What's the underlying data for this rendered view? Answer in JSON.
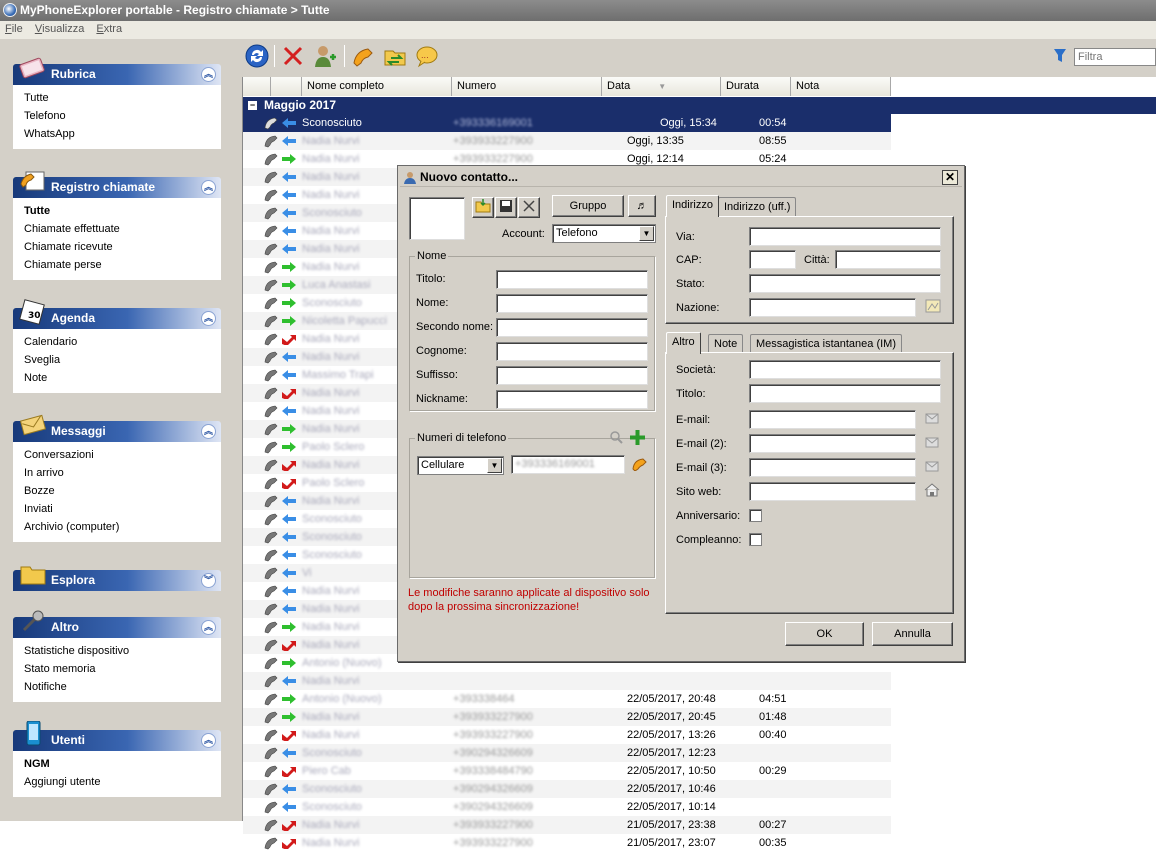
{
  "window": {
    "title": "MyPhoneExplorer portable -  Registro chiamate > Tutte"
  },
  "menu": [
    {
      "key": "F",
      "rest": "ile"
    },
    {
      "key": "V",
      "rest": "isualizza"
    },
    {
      "key": "E",
      "rest": "xtra"
    }
  ],
  "sidebar": {
    "rubrica": {
      "title": "Rubrica",
      "items": [
        "Tutte",
        "Telefono",
        "WhatsApp"
      ]
    },
    "registro": {
      "title": "Registro chiamate",
      "items": [
        "Tutte",
        "Chiamate effettuate",
        "Chiamate ricevute",
        "Chiamate perse"
      ]
    },
    "agenda": {
      "title": "Agenda",
      "items": [
        "Calendario",
        "Sveglia",
        "Note"
      ]
    },
    "messaggi": {
      "title": "Messaggi",
      "items": [
        "Conversazioni",
        "In arrivo",
        "Bozze",
        "Inviati",
        "Archivio (computer)"
      ]
    },
    "esplora": {
      "title": "Esplora"
    },
    "altro": {
      "title": "Altro",
      "items": [
        "Statistiche dispositivo",
        "Stato memoria",
        "Notifiche"
      ]
    },
    "utenti": {
      "title": "Utenti",
      "items": [
        "NGM",
        "Aggiungi utente"
      ]
    }
  },
  "toolbar": {
    "filter_placeholder": "Filtra"
  },
  "grid": {
    "columns": [
      "Nome completo",
      "Numero",
      "Data",
      "Durata",
      "Nota"
    ],
    "group": "Maggio 2017",
    "rows": [
      {
        "dir": "in",
        "name": "Sconosciuto",
        "number": "+393336169001",
        "date": "Oggi, 15:34",
        "duration": "00:54",
        "selected": true
      },
      {
        "dir": "in",
        "name": "Nadia Nurvi",
        "number": "+393933227900",
        "date": "Oggi, 13:35",
        "duration": "08:55"
      },
      {
        "dir": "out",
        "name": "Nadia Nurvi",
        "number": "+393933227900",
        "date": "Oggi, 12:14",
        "duration": "05:24"
      },
      {
        "dir": "in",
        "name": "Nadia Nurvi",
        "number": "",
        "date": "",
        "duration": ""
      },
      {
        "dir": "in",
        "name": "Nadia Nurvi",
        "number": "",
        "date": "",
        "duration": ""
      },
      {
        "dir": "in",
        "name": "Sconosciuto",
        "number": "",
        "date": "",
        "duration": ""
      },
      {
        "dir": "in",
        "name": "Nadia Nurvi",
        "number": "",
        "date": "",
        "duration": ""
      },
      {
        "dir": "in",
        "name": "Nadia Nurvi",
        "number": "",
        "date": "",
        "duration": ""
      },
      {
        "dir": "out",
        "name": "Nadia Nurvi",
        "number": "",
        "date": "",
        "duration": ""
      },
      {
        "dir": "out",
        "name": "Luca Anastasi",
        "number": "",
        "date": "",
        "duration": ""
      },
      {
        "dir": "out",
        "name": "Sconosciuto",
        "number": "",
        "date": "",
        "duration": ""
      },
      {
        "dir": "out",
        "name": "Nicoletta Papucci",
        "number": "",
        "date": "",
        "duration": ""
      },
      {
        "dir": "miss",
        "name": "Nadia Nurvi",
        "number": "",
        "date": "",
        "duration": ""
      },
      {
        "dir": "in",
        "name": "Nadia Nurvi",
        "number": "",
        "date": "",
        "duration": ""
      },
      {
        "dir": "in",
        "name": "Massimo Trapi",
        "number": "",
        "date": "",
        "duration": ""
      },
      {
        "dir": "miss",
        "name": "Nadia Nurvi",
        "number": "",
        "date": "",
        "duration": ""
      },
      {
        "dir": "in",
        "name": "Nadia Nurvi",
        "number": "",
        "date": "",
        "duration": ""
      },
      {
        "dir": "out",
        "name": "Nadia Nurvi",
        "number": "",
        "date": "",
        "duration": ""
      },
      {
        "dir": "out",
        "name": "Paolo Sclero",
        "number": "",
        "date": "",
        "duration": ""
      },
      {
        "dir": "miss",
        "name": "Nadia Nurvi",
        "number": "",
        "date": "",
        "duration": ""
      },
      {
        "dir": "miss",
        "name": "Paolo Sclero",
        "number": "",
        "date": "",
        "duration": ""
      },
      {
        "dir": "in",
        "name": "Nadia Nurvi",
        "number": "",
        "date": "",
        "duration": ""
      },
      {
        "dir": "in",
        "name": "Sconosciuto",
        "number": "",
        "date": "",
        "duration": ""
      },
      {
        "dir": "in",
        "name": "Sconosciuto",
        "number": "",
        "date": "",
        "duration": ""
      },
      {
        "dir": "in",
        "name": "Sconosciuto",
        "number": "",
        "date": "",
        "duration": ""
      },
      {
        "dir": "in",
        "name": "Vi",
        "number": "",
        "date": "",
        "duration": ""
      },
      {
        "dir": "in",
        "name": "Nadia Nurvi",
        "number": "",
        "date": "",
        "duration": ""
      },
      {
        "dir": "in",
        "name": "Nadia Nurvi",
        "number": "",
        "date": "",
        "duration": ""
      },
      {
        "dir": "out",
        "name": "Nadia Nurvi",
        "number": "",
        "date": "",
        "duration": ""
      },
      {
        "dir": "miss",
        "name": "Nadia Nurvi",
        "number": "",
        "date": "",
        "duration": ""
      },
      {
        "dir": "out",
        "name": "Antonio (Nuovo)",
        "number": "",
        "date": "",
        "duration": ""
      },
      {
        "dir": "in",
        "name": "Nadia Nurvi",
        "number": "",
        "date": "",
        "duration": ""
      },
      {
        "dir": "out",
        "name": "Antonio (Nuovo)",
        "number": "+393338464",
        "date": "22/05/2017, 20:48",
        "duration": "04:51"
      },
      {
        "dir": "out",
        "name": "Nadia Nurvi",
        "number": "+393933227900",
        "date": "22/05/2017, 20:45",
        "duration": "01:48"
      },
      {
        "dir": "miss",
        "name": "Nadia Nurvi",
        "number": "+393933227900",
        "date": "22/05/2017, 13:26",
        "duration": "00:40"
      },
      {
        "dir": "in",
        "name": "Sconosciuto",
        "number": "+390294326609",
        "date": "22/05/2017, 12:23",
        "duration": ""
      },
      {
        "dir": "miss",
        "name": "Piero Cab",
        "number": "+393338484790",
        "date": "22/05/2017, 10:50",
        "duration": "00:29"
      },
      {
        "dir": "in",
        "name": "Sconosciuto",
        "number": "+390294326609",
        "date": "22/05/2017, 10:46",
        "duration": ""
      },
      {
        "dir": "in",
        "name": "Sconosciuto",
        "number": "+390294326609",
        "date": "22/05/2017, 10:14",
        "duration": ""
      },
      {
        "dir": "miss",
        "name": "Nadia Nurvi",
        "number": "+393933227900",
        "date": "21/05/2017, 23:38",
        "duration": "00:27"
      },
      {
        "dir": "miss",
        "name": "Nadia Nurvi",
        "number": "+393933227900",
        "date": "21/05/2017, 23:07",
        "duration": "00:35"
      }
    ]
  },
  "dialog": {
    "title": "Nuovo contatto...",
    "group_button": "Gruppo",
    "account_label": "Account:",
    "account_value": "Telefono",
    "name_group": "Nome",
    "name_fields": [
      "Titolo:",
      "Nome:",
      "Secondo nome:",
      "Cognome:",
      "Suffisso:",
      "Nickname:"
    ],
    "phones_group": "Numeri di telefono",
    "phone_type": "Cellulare",
    "phone_value": "+393336169001",
    "warning": "Le modifiche saranno applicate al dispositivo solo dopo la prossima sincronizzazione!",
    "address_tabs": [
      "Indirizzo",
      "Indirizzo (uff.)"
    ],
    "address": {
      "via": "Via:",
      "cap": "CAP:",
      "citta": "Città:",
      "stato": "Stato:",
      "nazione": "Nazione:"
    },
    "other_tabs": [
      "Altro",
      "Note",
      "Messagistica istantanea (IM)"
    ],
    "other": {
      "societa": "Società:",
      "titolo": "Titolo:",
      "email1": "E-mail:",
      "email2": "E-mail (2):",
      "email3": "E-mail (3):",
      "sito": "Sito web:",
      "anniversario": "Anniversario:",
      "compleanno": "Compleanno:"
    },
    "ok": "OK",
    "cancel": "Annulla"
  },
  "colors": {
    "header_blue": "#1a2e6b",
    "in_arrow": "#3a8ee6",
    "out_arrow": "#2fbf2f",
    "missed_arrow": "#d21a1a",
    "warning_text": "#c00000"
  }
}
